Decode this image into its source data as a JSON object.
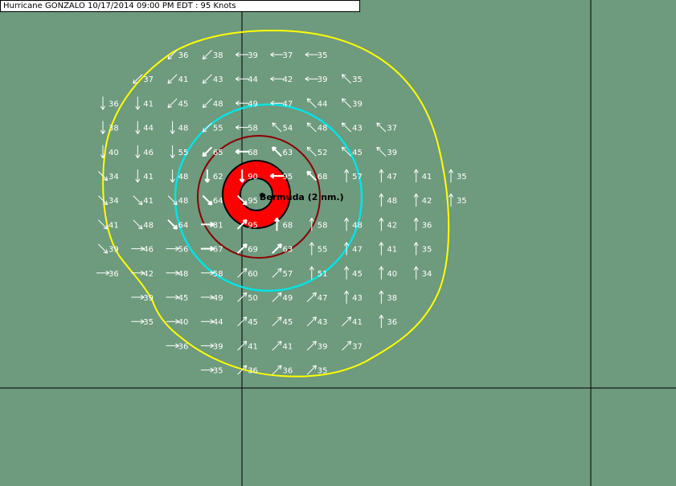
{
  "title": "Hurricane GONZALO 10/17/2014 09:00 PM EDT : 95 Knots",
  "location": {
    "label": "Bermuda (2 nm.)"
  },
  "colors": {
    "background": "#6e9a7e",
    "outer_ring": "#ffff00",
    "mid_ring": "#00e5e5",
    "inner_ring": "#8b0000",
    "eyewall": "#ff0000",
    "eye": "#6e9a7e",
    "vectors": "#ffffff",
    "gridlines": "#000000"
  },
  "wind_grid": {
    "rows": [
      {
        "cells": [
          [
            null,
            null
          ],
          [
            null,
            null
          ],
          [
            36,
            "sw"
          ],
          [
            38,
            "sw"
          ],
          [
            39,
            "w"
          ],
          [
            37,
            "w"
          ],
          [
            35,
            "w"
          ],
          [
            null,
            null
          ],
          [
            null,
            null
          ],
          [
            null,
            null
          ],
          [
            null,
            null
          ]
        ]
      },
      {
        "cells": [
          [
            null,
            null
          ],
          [
            37,
            "sw"
          ],
          [
            41,
            "sw"
          ],
          [
            43,
            "sw"
          ],
          [
            44,
            "w"
          ],
          [
            42,
            "w"
          ],
          [
            39,
            "w"
          ],
          [
            35,
            "nw"
          ],
          [
            null,
            null
          ],
          [
            null,
            null
          ],
          [
            null,
            null
          ]
        ]
      },
      {
        "cells": [
          [
            36,
            "s"
          ],
          [
            41,
            "s"
          ],
          [
            45,
            "sw"
          ],
          [
            48,
            "sw"
          ],
          [
            49,
            "w"
          ],
          [
            47,
            "w"
          ],
          [
            44,
            "nw"
          ],
          [
            39,
            "nw"
          ],
          [
            null,
            null
          ],
          [
            null,
            null
          ],
          [
            null,
            null
          ]
        ]
      },
      {
        "cells": [
          [
            38,
            "s"
          ],
          [
            44,
            "s"
          ],
          [
            48,
            "s"
          ],
          [
            55,
            "sw"
          ],
          [
            58,
            "w"
          ],
          [
            54,
            "nw"
          ],
          [
            48,
            "nw"
          ],
          [
            43,
            "nw"
          ],
          [
            37,
            "nw"
          ],
          [
            null,
            null
          ],
          [
            null,
            null
          ]
        ]
      },
      {
        "cells": [
          [
            40,
            "s"
          ],
          [
            46,
            "s"
          ],
          [
            55,
            "s"
          ],
          [
            65,
            "sw"
          ],
          [
            68,
            "w"
          ],
          [
            63,
            "nw"
          ],
          [
            52,
            "nw"
          ],
          [
            45,
            "nw"
          ],
          [
            39,
            "nw"
          ],
          [
            null,
            null
          ],
          [
            null,
            null
          ]
        ]
      },
      {
        "cells": [
          [
            34,
            "se"
          ],
          [
            41,
            "s"
          ],
          [
            48,
            "s"
          ],
          [
            62,
            "s"
          ],
          [
            90,
            "s"
          ],
          [
            95,
            "w"
          ],
          [
            68,
            "nw"
          ],
          [
            57,
            "n"
          ],
          [
            47,
            "n"
          ],
          [
            41,
            "n"
          ],
          [
            35,
            "n"
          ]
        ]
      },
      {
        "cells": [
          [
            34,
            "se"
          ],
          [
            41,
            "se"
          ],
          [
            48,
            "se"
          ],
          [
            64,
            "se"
          ],
          [
            95,
            "se"
          ],
          [
            null,
            null
          ],
          [
            null,
            null
          ],
          [
            null,
            null
          ],
          [
            48,
            "n"
          ],
          [
            42,
            "n"
          ],
          [
            35,
            "n"
          ]
        ]
      },
      {
        "cells": [
          [
            41,
            "se"
          ],
          [
            48,
            "se"
          ],
          [
            64,
            "se"
          ],
          [
            81,
            "e"
          ],
          [
            95,
            "ne"
          ],
          [
            68,
            "n"
          ],
          [
            58,
            "n"
          ],
          [
            48,
            "n"
          ],
          [
            42,
            "n"
          ],
          [
            36,
            "n"
          ],
          [
            null,
            null
          ]
        ]
      },
      {
        "cells": [
          [
            39,
            "se"
          ],
          [
            46,
            "e"
          ],
          [
            56,
            "e"
          ],
          [
            67,
            "e"
          ],
          [
            69,
            "ne"
          ],
          [
            63,
            "ne"
          ],
          [
            55,
            "n"
          ],
          [
            47,
            "n"
          ],
          [
            41,
            "n"
          ],
          [
            35,
            "n"
          ],
          [
            null,
            null
          ]
        ]
      },
      {
        "cells": [
          [
            36,
            "e"
          ],
          [
            42,
            "e"
          ],
          [
            48,
            "e"
          ],
          [
            58,
            "e"
          ],
          [
            60,
            "ne"
          ],
          [
            57,
            "ne"
          ],
          [
            51,
            "n"
          ],
          [
            45,
            "n"
          ],
          [
            40,
            "n"
          ],
          [
            34,
            "n"
          ],
          [
            null,
            null
          ]
        ]
      },
      {
        "cells": [
          [
            null,
            null
          ],
          [
            39,
            "e"
          ],
          [
            45,
            "e"
          ],
          [
            49,
            "e"
          ],
          [
            50,
            "ne"
          ],
          [
            49,
            "ne"
          ],
          [
            47,
            "ne"
          ],
          [
            43,
            "n"
          ],
          [
            38,
            "n"
          ],
          [
            null,
            null
          ],
          [
            null,
            null
          ]
        ]
      },
      {
        "cells": [
          [
            null,
            null
          ],
          [
            35,
            "e"
          ],
          [
            40,
            "e"
          ],
          [
            44,
            "e"
          ],
          [
            45,
            "ne"
          ],
          [
            45,
            "ne"
          ],
          [
            43,
            "ne"
          ],
          [
            41,
            "ne"
          ],
          [
            36,
            "n"
          ],
          [
            null,
            null
          ],
          [
            null,
            null
          ]
        ]
      },
      {
        "cells": [
          [
            null,
            null
          ],
          [
            null,
            null
          ],
          [
            36,
            "e"
          ],
          [
            39,
            "e"
          ],
          [
            41,
            "ne"
          ],
          [
            41,
            "ne"
          ],
          [
            39,
            "ne"
          ],
          [
            37,
            "ne"
          ],
          [
            null,
            null
          ],
          [
            null,
            null
          ],
          [
            null,
            null
          ]
        ]
      },
      {
        "cells": [
          [
            null,
            null
          ],
          [
            null,
            null
          ],
          [
            null,
            null
          ],
          [
            35,
            "e"
          ],
          [
            36,
            "ne"
          ],
          [
            36,
            "ne"
          ],
          [
            35,
            "ne"
          ],
          [
            null,
            null
          ],
          [
            null,
            null
          ],
          [
            null,
            null
          ],
          [
            null,
            null
          ]
        ]
      }
    ]
  }
}
